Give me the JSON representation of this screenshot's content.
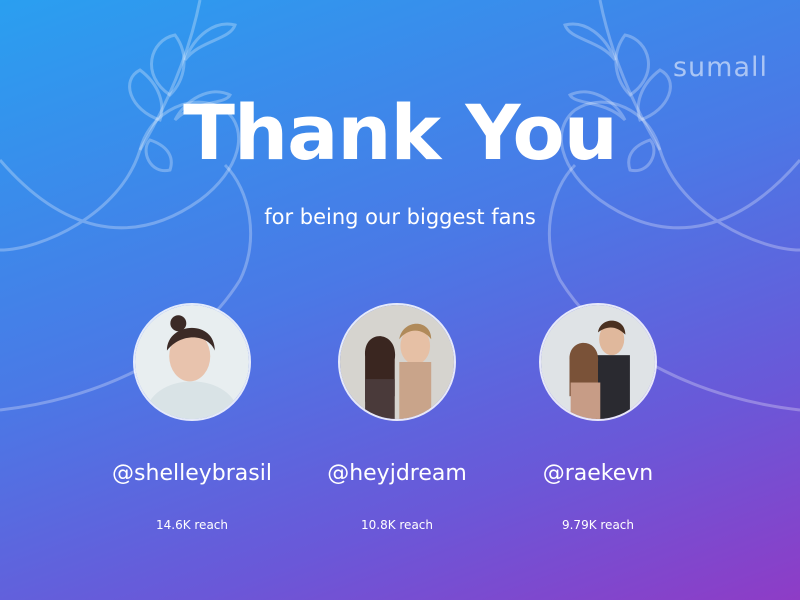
{
  "brand": "sumall",
  "title": "Thank You",
  "subtitle": "for being our biggest fans",
  "fans": [
    {
      "handle": "@shelleybrasil",
      "reach": "14.6K reach"
    },
    {
      "handle": "@heyjdream",
      "reach": "10.8K reach"
    },
    {
      "handle": "@raekevn",
      "reach": "9.79K reach"
    }
  ]
}
